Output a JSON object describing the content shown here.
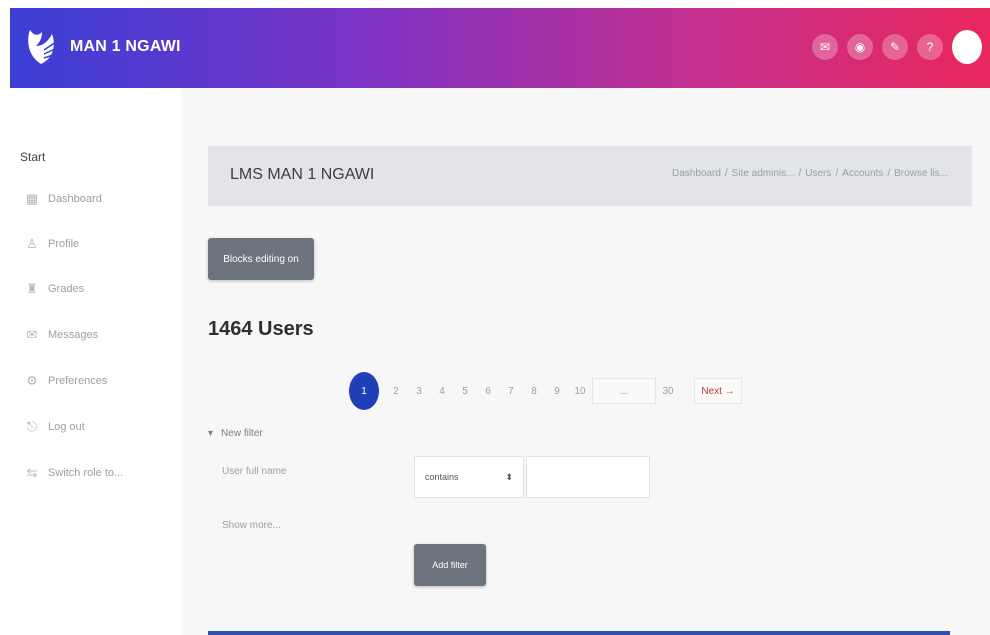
{
  "header": {
    "brand": "MAN 1 NGAWI",
    "icons": [
      "chat-icon",
      "bell-icon",
      "link-icon",
      "help-icon"
    ]
  },
  "sidebar": {
    "title": "Start",
    "items": [
      {
        "label": "Dashboard",
        "icon": "grid-icon"
      },
      {
        "label": "Profile",
        "icon": "user-icon"
      },
      {
        "label": "Grades",
        "icon": "grades-icon"
      },
      {
        "label": "Messages",
        "icon": "message-icon"
      },
      {
        "label": "Preferences",
        "icon": "settings-icon"
      },
      {
        "label": "Log out",
        "icon": "logout-icon"
      },
      {
        "label": "Switch role to...",
        "icon": "switch-role-icon"
      }
    ]
  },
  "main": {
    "page_title": "LMS MAN 1 NGAWI",
    "breadcrumb": [
      "Dashboard",
      "Site adminis...",
      "Users",
      "Accounts",
      "Browse lis..."
    ],
    "blocks_button": "Blocks editing on",
    "users_heading": "1464 Users",
    "pagination": {
      "active": "1",
      "pages": [
        "2",
        "3",
        "4",
        "5",
        "6",
        "7",
        "8",
        "9",
        "10"
      ],
      "ellipsis": "...",
      "last": "30",
      "next": "Next →"
    },
    "filter": {
      "toggle": "New filter",
      "field_label": "User full name",
      "select_value": "contains",
      "input_value": "",
      "show_more": "Show more...",
      "add_button": "Add filter"
    }
  },
  "colors": {
    "header_start": "#3a3fd6",
    "header_end": "#e8275c",
    "active_page": "#1e3fb8",
    "button": "#6c757d"
  }
}
